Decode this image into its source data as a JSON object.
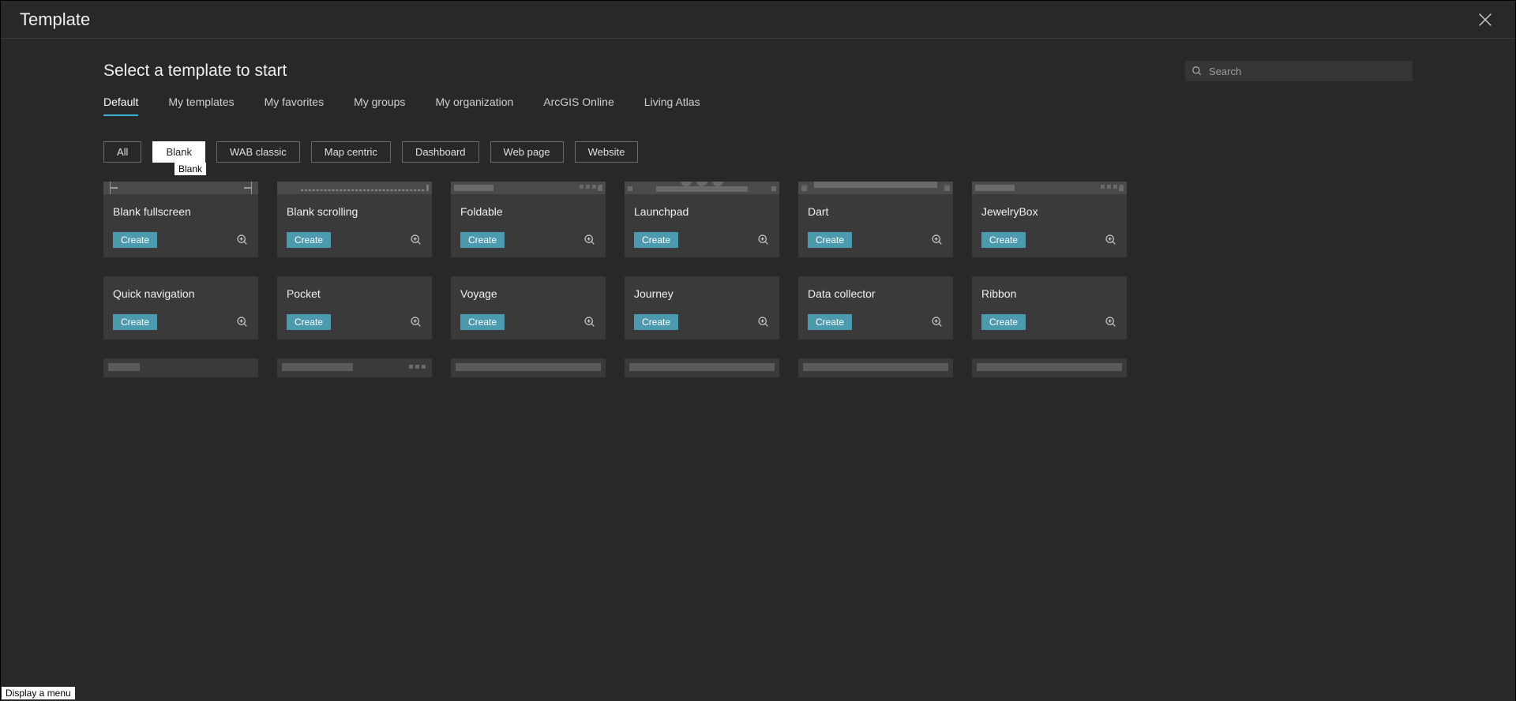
{
  "modal": {
    "title": "Template",
    "subtitle": "Select a template to start",
    "search_placeholder": "Search"
  },
  "tabs": [
    {
      "label": "Default",
      "active": true
    },
    {
      "label": "My templates",
      "active": false
    },
    {
      "label": "My favorites",
      "active": false
    },
    {
      "label": "My groups",
      "active": false
    },
    {
      "label": "My organization",
      "active": false
    },
    {
      "label": "ArcGIS Online",
      "active": false
    },
    {
      "label": "Living Atlas",
      "active": false
    }
  ],
  "filters": [
    {
      "label": "All",
      "active": false
    },
    {
      "label": "Blank",
      "active": true
    },
    {
      "label": "WAB classic",
      "active": false
    },
    {
      "label": "Map centric",
      "active": false
    },
    {
      "label": "Dashboard",
      "active": false
    },
    {
      "label": "Web page",
      "active": false
    },
    {
      "label": "Website",
      "active": false
    }
  ],
  "tooltip": "Blank",
  "status_tooltip": "Display a menu",
  "templates": [
    {
      "name": "Blank fullscreen",
      "create": "Create"
    },
    {
      "name": "Blank scrolling",
      "create": "Create"
    },
    {
      "name": "Foldable",
      "create": "Create"
    },
    {
      "name": "Launchpad",
      "create": "Create"
    },
    {
      "name": "Dart",
      "create": "Create"
    },
    {
      "name": "JewelryBox",
      "create": "Create"
    },
    {
      "name": "Quick navigation",
      "create": "Create"
    },
    {
      "name": "Pocket",
      "create": "Create"
    },
    {
      "name": "Voyage",
      "create": "Create"
    },
    {
      "name": "Journey",
      "create": "Create"
    },
    {
      "name": "Data collector",
      "create": "Create"
    },
    {
      "name": "Ribbon",
      "create": "Create"
    }
  ]
}
